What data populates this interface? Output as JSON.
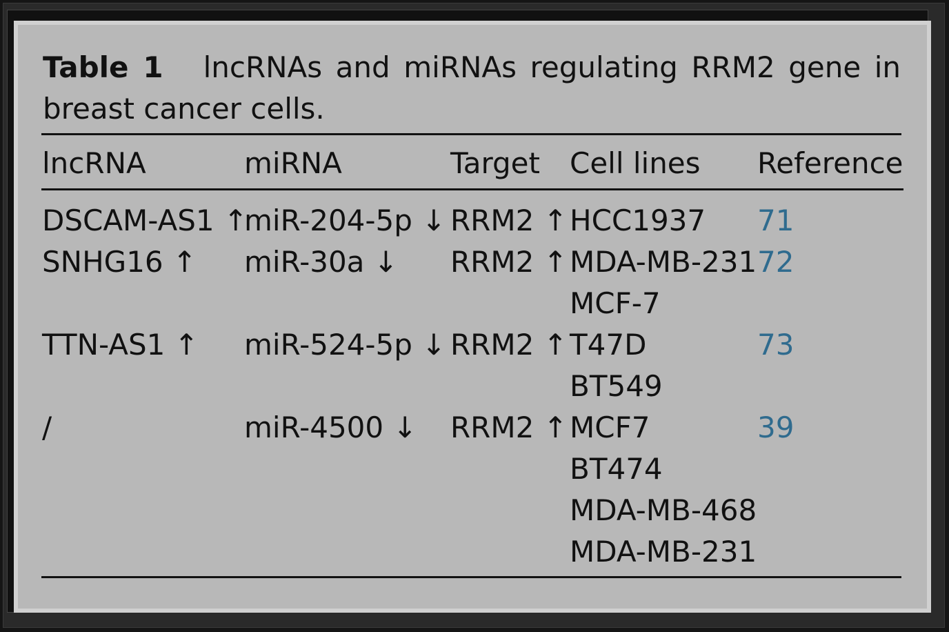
{
  "caption": {
    "label": "Table 1",
    "text": "lncRNAs and miRNAs regulating RRM2 gene in breast cancer cells."
  },
  "columns": [
    "lncRNA",
    "miRNA",
    "Target",
    "Cell lines",
    "Reference"
  ],
  "rows": [
    {
      "lncrna": "DSCAM-AS1 ↑",
      "mirna": "miR-204-5p ↓",
      "target": "RRM2 ↑",
      "cell_lines": [
        "HCC1937"
      ],
      "reference": "71"
    },
    {
      "lncrna": "SNHG16 ↑",
      "mirna": "miR-30a ↓",
      "target": "RRM2 ↑",
      "cell_lines": [
        "MDA-MB-231",
        "MCF-7"
      ],
      "reference": "72"
    },
    {
      "lncrna": "TTN-AS1 ↑",
      "mirna": "miR-524-5p ↓",
      "target": "RRM2 ↑",
      "cell_lines": [
        "T47D",
        "BT549"
      ],
      "reference": "73"
    },
    {
      "lncrna": "/",
      "mirna": "miR-4500 ↓",
      "target": "RRM2 ↑",
      "cell_lines": [
        "MCF7",
        "BT474",
        "MDA-MB-468",
        "MDA-MB-231"
      ],
      "reference": "39"
    }
  ],
  "colors": {
    "background": "#b8b8b8",
    "text": "#111111",
    "reference_link": "#2f6b8e",
    "frame": "#151515"
  }
}
